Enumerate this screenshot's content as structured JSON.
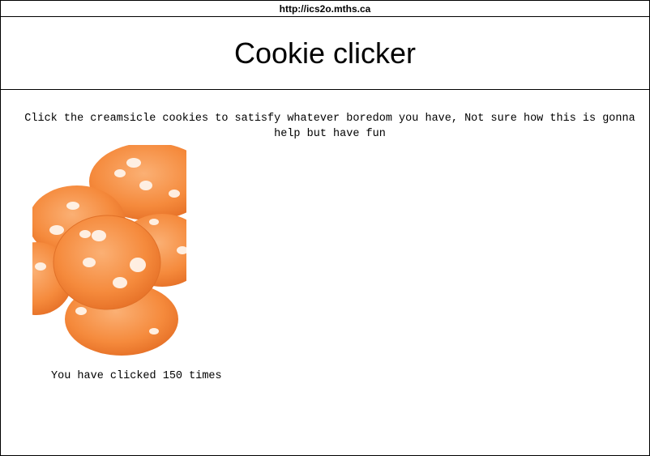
{
  "browser": {
    "url": "http://ics2o.mths.ca"
  },
  "page": {
    "title": "Cookie clicker",
    "intro": "Click the creamsicle cookies to satisfy whatever boredom you have, Not sure how this is gonna help but have fun",
    "counter_text": "You have clicked 150 times"
  },
  "colors": {
    "cookie_orange": "#f58a3c",
    "cookie_light": "#fbb074",
    "chip_white": "#fff4ea"
  }
}
